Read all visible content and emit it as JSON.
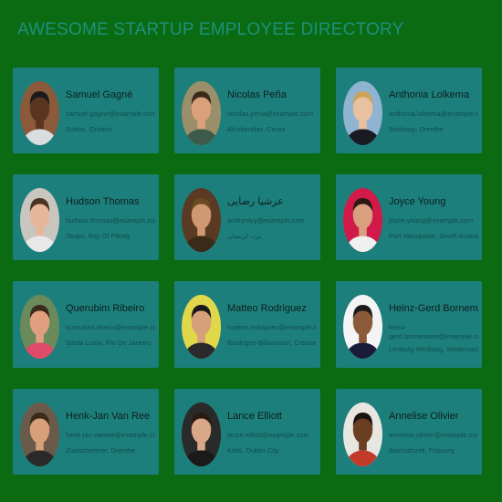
{
  "header": {
    "title": "AWESOME STARTUP EMPLOYEE DIRECTORY"
  },
  "employees": [
    {
      "name": "Samuel Gagné",
      "email": "samuel.gagne@example.com",
      "location": "Sutton, Ontario",
      "avatar_bg": "#8a5a3a",
      "skin": "#5a3520",
      "shirt": "#d8dde0",
      "hair": "#1a1a1a"
    },
    {
      "name": "Nicolas Peña",
      "email": "nicolas.pena@example.com",
      "location": "Alcobendas, Ceuta",
      "avatar_bg": "#9a8f6a",
      "skin": "#d9a07a",
      "shirt": "#3d5a4a",
      "hair": "#3a2a1a"
    },
    {
      "name": "Anthonia Lolkema",
      "email": "anthonia.lolkema@example.com",
      "location": "Boskoop, Drenthe",
      "avatar_bg": "#8fb3d0",
      "skin": "#e8c2a0",
      "shirt": "#1a1a22",
      "hair": "#c9a45a"
    },
    {
      "name": "Hudson Thomas",
      "email": "hudson.thomas@example.com",
      "location": "Taupo, Bay Of Plenty",
      "avatar_bg": "#c9c6c0",
      "skin": "#e6b59a",
      "shirt": "#e8e8e8",
      "hair": "#4a3322"
    },
    {
      "name": "عرشیا رضایی",
      "email": "arshyrdyy@example.com",
      "location": "یزد، لرستان",
      "avatar_bg": "#5a3a22",
      "skin": "#d09870",
      "shirt": "#3a2a18",
      "hair": "#6a4a22"
    },
    {
      "name": "Joyce Young",
      "email": "joyce.young@example.com",
      "location": "Port Macquarie, South Australia",
      "avatar_bg": "#d21a4a",
      "skin": "#d9a080",
      "shirt": "#f0f0f0",
      "hair": "#2a1a14"
    },
    {
      "name": "Querubim Ribeiro",
      "email": "querubim.ribeiro@example.com",
      "location": "Santa Luzia, Rio De Janeiro",
      "avatar_bg": "#6a8a5a",
      "skin": "#e0a080",
      "shirt": "#e04a6a",
      "hair": "#3a2a1a"
    },
    {
      "name": "Matteo Rodriguez",
      "email": "matteo.rodriguez@example.com",
      "location": "Boulogne-Billancourt, Creuse",
      "avatar_bg": "#e0d84a",
      "skin": "#d6a07a",
      "shirt": "#2a2a2a",
      "hair": "#1a1a1a"
    },
    {
      "name": "Heinz-Gerd Bornemann",
      "email": "heinz-gerd.bornemann@example.com",
      "location": "Limburg-Weilburg, Niedersachsen",
      "avatar_bg": "#f4f4f4",
      "skin": "#8a5a3a",
      "shirt": "#1a1a3a",
      "hair": "#1a1a1a"
    },
    {
      "name": "Henk-Jan Van Ree",
      "email": "henk-jan.vanree@example.com",
      "location": "Zuidschermer, Drenthe",
      "avatar_bg": "#6a5a4a",
      "skin": "#d8a07a",
      "shirt": "#2a2a2a",
      "hair": "#3a2a1a"
    },
    {
      "name": "Lance Elliott",
      "email": "lance.elliott@example.com",
      "location": "Kells, Dublin City",
      "avatar_bg": "#2a2a2a",
      "skin": "#d9a888",
      "shirt": "#1a1a1a",
      "hair": "#2a1a12"
    },
    {
      "name": "Annelise Olivier",
      "email": "annelise.olivier@example.com",
      "location": "Bischofszell, Fribourg",
      "avatar_bg": "#e8e6e0",
      "skin": "#6a3e22",
      "shirt": "#c23a2a",
      "hair": "#1a1410"
    }
  ]
}
